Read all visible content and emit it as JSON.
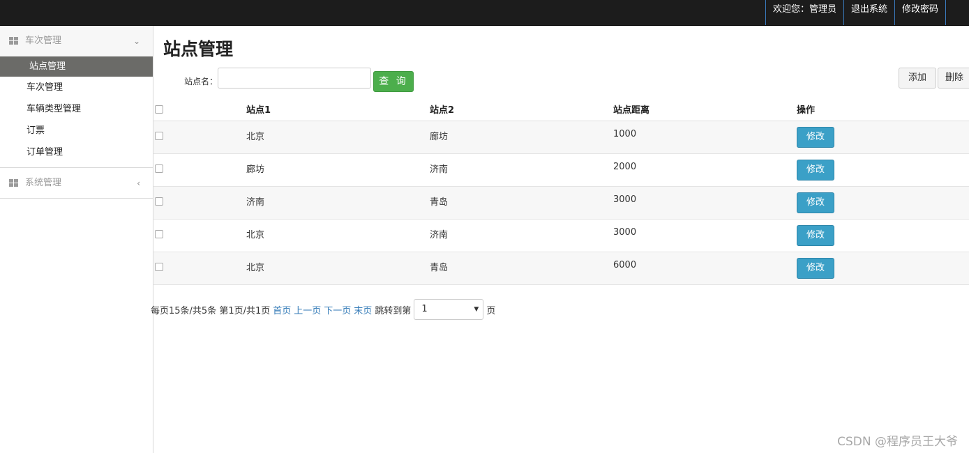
{
  "topbar": {
    "welcome": "欢迎您：管理员",
    "logout": "退出系统",
    "change_password": "修改密码"
  },
  "sidebar": {
    "groups": [
      {
        "label": "车次管理",
        "expanded": true,
        "items": [
          {
            "label": "站点管理",
            "active": true
          },
          {
            "label": "车次管理"
          },
          {
            "label": "车辆类型管理"
          },
          {
            "label": "订票"
          },
          {
            "label": "订单管理"
          }
        ]
      },
      {
        "label": "系统管理",
        "expanded": false
      }
    ]
  },
  "main": {
    "title": "站点管理",
    "search_label": "站点名：",
    "search_value": "",
    "query_button": "查 询",
    "add_button": "添加",
    "delete_button": "删除",
    "table": {
      "headers": [
        "站点1",
        "站点2",
        "站点距离",
        "操作"
      ],
      "edit_label": "修改",
      "rows": [
        {
          "station1": "北京",
          "station2": "廊坊",
          "distance": "1000"
        },
        {
          "station1": "廊坊",
          "station2": "济南",
          "distance": "2000"
        },
        {
          "station1": "济南",
          "station2": "青岛",
          "distance": "3000"
        },
        {
          "station1": "北京",
          "station2": "济南",
          "distance": "3000"
        },
        {
          "station1": "北京",
          "station2": "青岛",
          "distance": "6000"
        }
      ]
    },
    "pager": {
      "info": "每页15条/共5条 第1页/共1页",
      "first": "首页",
      "prev": "上一页",
      "next": "下一页",
      "last": "末页",
      "jump_prefix": "跳转到第",
      "page_value": "1",
      "jump_suffix": "页"
    }
  },
  "watermark": "CSDN @程序员王大爷",
  "colors": {
    "topbar": "#1c1c1c",
    "active_item": "#6b6b68",
    "query_button": "#4cae4c",
    "edit_button": "#3ba0c7",
    "link": "#337ab7"
  }
}
